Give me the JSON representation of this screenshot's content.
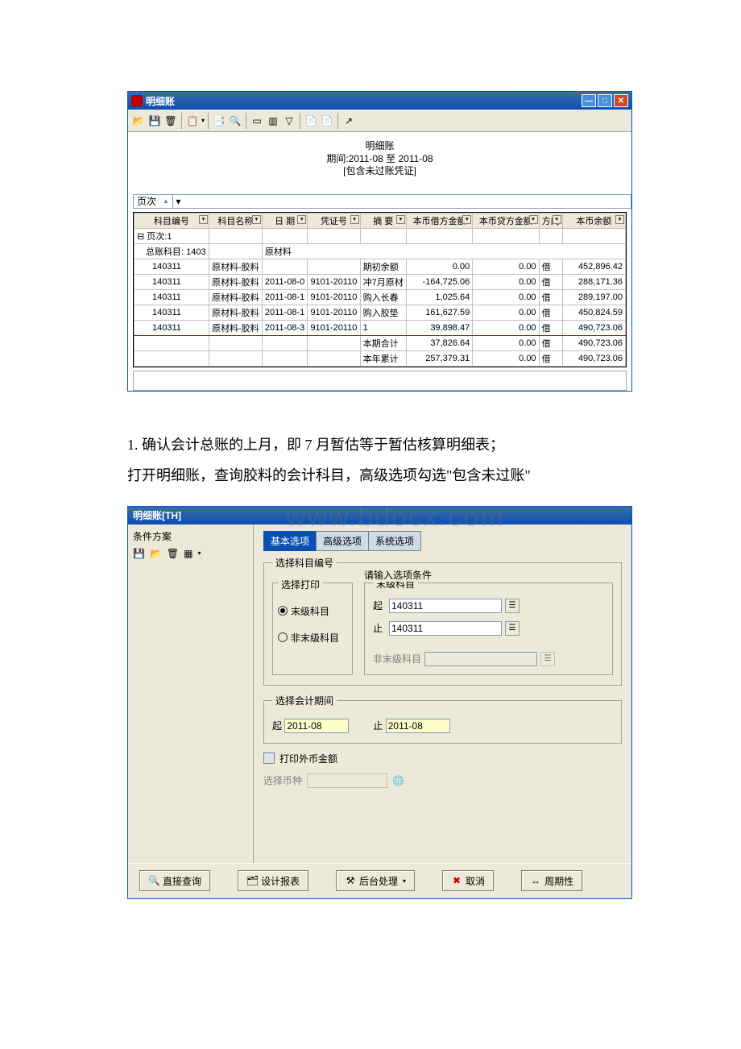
{
  "win1": {
    "title": "明细账",
    "heading_line1": "明细账",
    "heading_line2": "期间:2011-08 至 2011-08",
    "heading_line3": "[包含未过账凭证]",
    "page_label": "页次",
    "columns": [
      "科目编号",
      "科目名称",
      "日 期",
      "凭证号",
      "摘 要",
      "本币借方金额",
      "本币贷方金额",
      "方向",
      "本币余额"
    ],
    "group_header": {
      "page": "页次:1",
      "subject_code": "总账科目: 1403",
      "subject_name": "原材料"
    },
    "rows": [
      {
        "code": "140311",
        "name": "原材料-胶料",
        "date": "",
        "voucher": "",
        "summary": "期初余额",
        "debit": "0.00",
        "credit": "0.00",
        "dir": "借",
        "balance": "452,896.42"
      },
      {
        "code": "140311",
        "name": "原材料-胶料",
        "date": "2011-08-0",
        "voucher": "9101-20110",
        "summary": "冲7月原材",
        "debit": "-164,725.06",
        "credit": "0.00",
        "dir": "借",
        "balance": "288,171.36"
      },
      {
        "code": "140311",
        "name": "原材料-胶料",
        "date": "2011-08-1",
        "voucher": "9101-20110",
        "summary": "购入长春",
        "debit": "1,025.64",
        "credit": "0.00",
        "dir": "借",
        "balance": "289,197.00"
      },
      {
        "code": "140311",
        "name": "原材料-胶料",
        "date": "2011-08-1",
        "voucher": "9101-20110",
        "summary": "购入胶垫",
        "debit": "161,627.59",
        "credit": "0.00",
        "dir": "借",
        "balance": "450,824.59"
      },
      {
        "code": "140311",
        "name": "原材料-胶料",
        "date": "2011-08-3",
        "voucher": "9101-20110",
        "summary": "1",
        "debit": "39,898.47",
        "credit": "0.00",
        "dir": "借",
        "balance": "490,723.06"
      },
      {
        "code": "",
        "name": "",
        "date": "",
        "voucher": "",
        "summary": "本期合计",
        "debit": "37,826.64",
        "credit": "0.00",
        "dir": "借",
        "balance": "490,723.06"
      },
      {
        "code": "",
        "name": "",
        "date": "",
        "voucher": "",
        "summary": "本年累计",
        "debit": "257,379.31",
        "credit": "0.00",
        "dir": "借",
        "balance": "490,723.06"
      }
    ]
  },
  "paragraph_line1": "1. 确认会计总账的上月，即 7 月暂估等于暂估核算明细表；",
  "paragraph_line2": "打开明细账，查询胶料的会计科目，高级选项勾选\"包含未过账\"",
  "watermark": "www.bdocx.com",
  "win2": {
    "title": "明细账[TH]",
    "left_label": "条件方案",
    "tabs": {
      "t1": "基本选项",
      "t2": "高级选项",
      "t3": "系统选项"
    },
    "fs1_legend": "选择科目编号",
    "hint": "请输入选项条件",
    "print_legend": "选择打印",
    "radio1": "末级科目",
    "radio2": "非末级科目",
    "right_legend": "末级科目",
    "start_lbl": "起",
    "end_lbl": "止",
    "start_val": "140311",
    "end_val": "140311",
    "nonend_lbl": "非末级科目",
    "fs2_legend": "选择会计期间",
    "period_start": "2011-08",
    "period_end": "2011-08",
    "chk_lbl": "打印外币金额",
    "curr_lbl": "选择币种",
    "btn_query": "直接查询",
    "btn_design": "设计报表",
    "btn_bg": "后台处理",
    "btn_cancel": "取消",
    "btn_cycle": "周期性"
  }
}
